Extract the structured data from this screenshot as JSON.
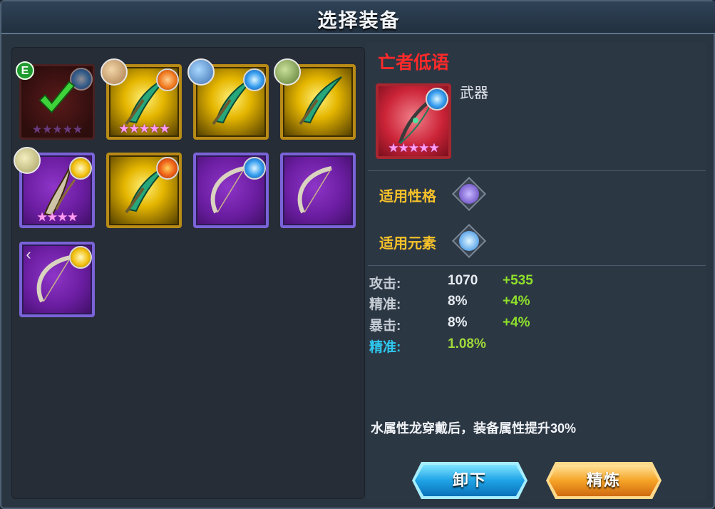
{
  "window": {
    "title": "选择装备"
  },
  "inventory": {
    "equipped_badge": "E",
    "slots": [
      {
        "frame": "dark",
        "equipped": true,
        "stars": "★★★★★",
        "star_style": "dim",
        "element": "water"
      },
      {
        "frame": "gold",
        "stars": "★★★★★",
        "star_style": "pink",
        "element": "earth",
        "dragon": "sand-dragon"
      },
      {
        "frame": "gold",
        "stars": "",
        "element": "water",
        "dragon": "blue-dragon"
      },
      {
        "frame": "gold",
        "stars": "",
        "element": "",
        "dragon": "green-dragon"
      },
      {
        "frame": "purple",
        "stars": "★★★★",
        "star_style": "pink",
        "element": "light",
        "dragon": "leaf-dragon"
      },
      {
        "frame": "gold",
        "stars": "",
        "element": "fire"
      },
      {
        "frame": "purple",
        "stars": "",
        "element": "water"
      },
      {
        "frame": "purple",
        "stars": "",
        "element": ""
      },
      {
        "frame": "purple",
        "stars": "",
        "element": "light"
      }
    ],
    "scroll_arrow": "‹"
  },
  "detail": {
    "name": "亡者低语",
    "type": "武器",
    "stars": "★★★★★",
    "element": "water",
    "personality_label": "适用性格",
    "personality_icon": "feather-wing-icon",
    "element_label": "适用元素",
    "element_icon": "water-drop-icon",
    "stats": [
      {
        "label": "攻击:",
        "value": "1070",
        "bonus": "+535"
      },
      {
        "label": "精准:",
        "value": "8%",
        "bonus": "+4%"
      },
      {
        "label": "暴击:",
        "value": "8%",
        "bonus": "+4%"
      },
      {
        "label": "精准:",
        "value": "1.08%",
        "bonus": ""
      }
    ],
    "description": "水属性龙穿戴后，装备属性提升30%"
  },
  "buttons": {
    "unequip": "卸下",
    "refine": "精炼"
  },
  "colors": {
    "item_name": "#ff2a2a",
    "label_gold": "#f7c22a",
    "bonus_green": "#8ee02a",
    "special_stat": "#2ec8f0"
  }
}
